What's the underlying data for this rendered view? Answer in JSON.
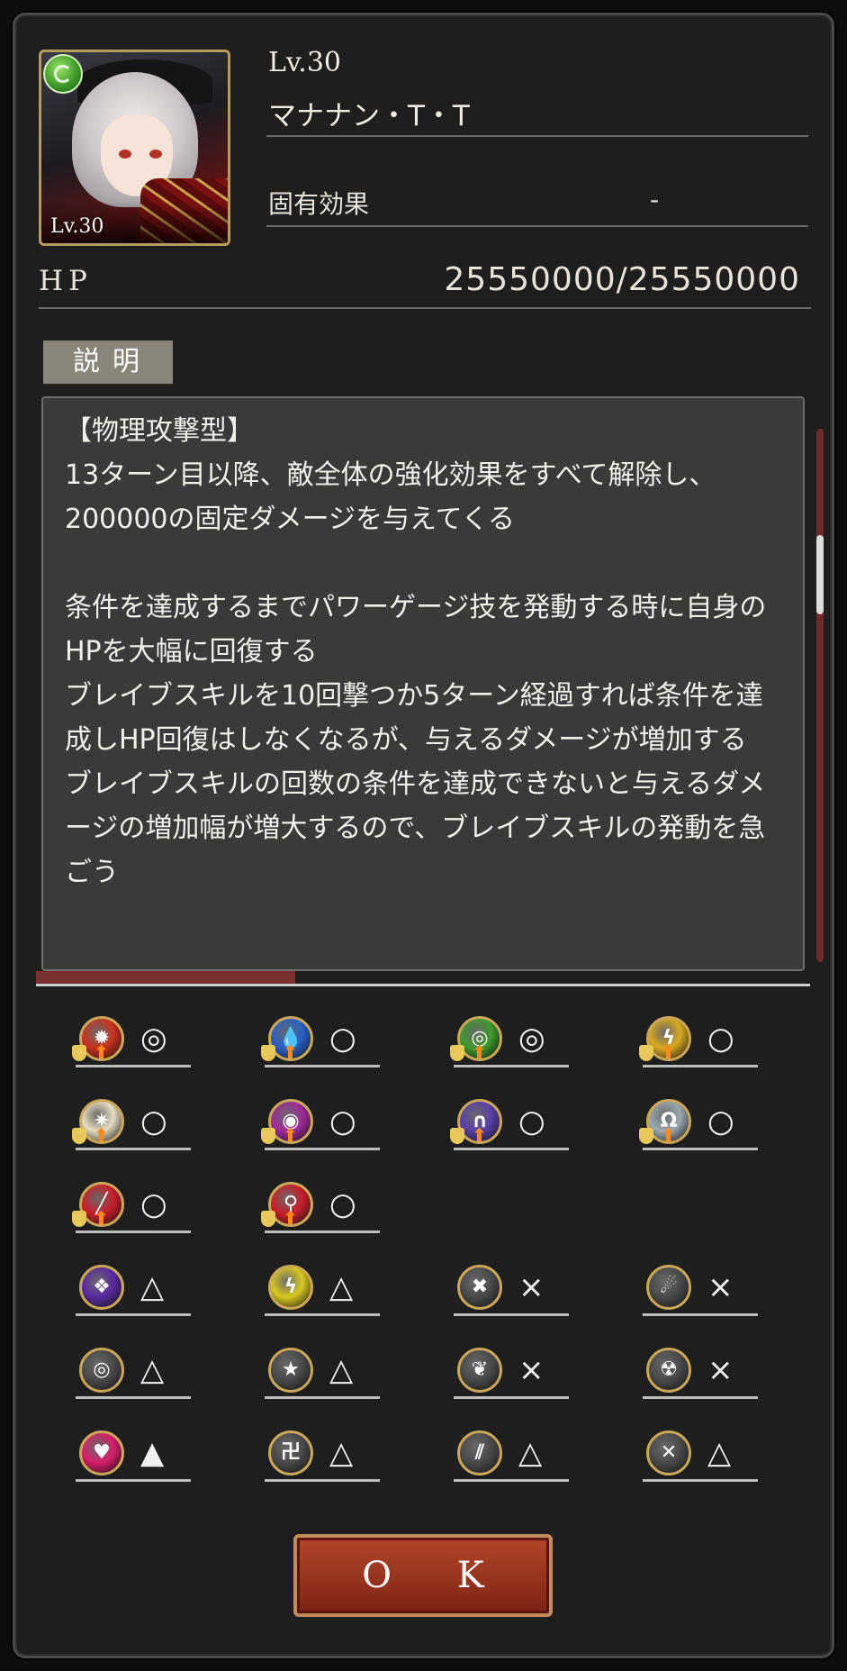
{
  "unit": {
    "level_label": "Lv.30",
    "portrait_level": "Lv.30",
    "name": "マナナン・T・T",
    "effect_label": "固有効果",
    "effect_value": "-",
    "hp_label": "HP",
    "hp_value": "25550000/25550000",
    "attribute_icon": "wind-attribute-icon"
  },
  "description": {
    "tab_label": "説明",
    "text": "【物理攻撃型】\n13ターン目以降、敵全体の強化効果をすべて解除し、200000の固定ダメージを与えてくる\n\n条件を達成するまでパワーゲージ技を発動する時に自身のHPを大幅に回復する\nブレイブスキルを10回撃つか5ターン経過すれば条件を達成しHP回復はしなくなるが、与えるダメージが増加する\nブレイブスキルの回数の条件を達成できないと与えるダメージの増加幅が増大するので、ブレイブスキルの発動を急ごう"
  },
  "resistances": [
    {
      "icon": "fire-resist-up-icon",
      "mark": "◎",
      "color": "#c8321e",
      "glyph": "✹"
    },
    {
      "icon": "water-resist-up-icon",
      "mark": "○",
      "color": "#2a5fc8",
      "glyph": "💧"
    },
    {
      "icon": "wind-resist-up-icon",
      "mark": "◎",
      "color": "#3d9a2a",
      "glyph": "◎"
    },
    {
      "icon": "thunder-resist-up-icon",
      "mark": "○",
      "color": "#d9a820",
      "glyph": "ϟ"
    },
    {
      "icon": "light-resist-up-icon",
      "mark": "○",
      "color": "#e6dcc0",
      "glyph": "✷"
    },
    {
      "icon": "dark-resist-up-icon",
      "mark": "○",
      "color": "#a02a9a",
      "glyph": "◉"
    },
    {
      "icon": "arcane-resist-up-icon",
      "mark": "○",
      "color": "#5a3fa8",
      "glyph": "∩"
    },
    {
      "icon": "holy-resist-up-icon",
      "mark": "○",
      "color": "#9aa8b0",
      "glyph": "Ω"
    },
    {
      "icon": "slash-resist-up-icon",
      "mark": "○",
      "color": "#c81e2a",
      "glyph": "╱"
    },
    {
      "icon": "magic-resist-up-icon",
      "mark": "○",
      "color": "#c81e2a",
      "glyph": "⚲"
    },
    {
      "icon": "poison-icon",
      "mark": "△",
      "color": "#5a2aa0",
      "glyph": "❖"
    },
    {
      "icon": "paralysis-icon",
      "mark": "△",
      "color": "#d9c820",
      "glyph": "ϟ"
    },
    {
      "icon": "instant-death-icon",
      "mark": "×",
      "color": "#4a4a4a",
      "glyph": "✖"
    },
    {
      "icon": "stun-icon",
      "mark": "×",
      "color": "#4a4a4a",
      "glyph": "☄"
    },
    {
      "icon": "blind-icon",
      "mark": "△",
      "color": "#4a4a4a",
      "glyph": "◎"
    },
    {
      "icon": "star-seal-icon",
      "mark": "△",
      "color": "#4a4a4a",
      "glyph": "★"
    },
    {
      "icon": "silence-icon",
      "mark": "×",
      "color": "#4a4a4a",
      "glyph": "❦"
    },
    {
      "icon": "confusion-icon",
      "mark": "×",
      "color": "#4a4a4a",
      "glyph": "☢"
    },
    {
      "icon": "charm-icon",
      "mark": "▲",
      "color": "#d81e6a",
      "glyph": "♥"
    },
    {
      "icon": "bind-icon",
      "mark": "△",
      "color": "#4a4a4a",
      "glyph": "卍"
    },
    {
      "icon": "claw-icon",
      "mark": "△",
      "color": "#4a4a4a",
      "glyph": "⫽"
    },
    {
      "icon": "break-icon",
      "mark": "△",
      "color": "#4a4a4a",
      "glyph": "✕"
    }
  ],
  "ok_button": "O K"
}
